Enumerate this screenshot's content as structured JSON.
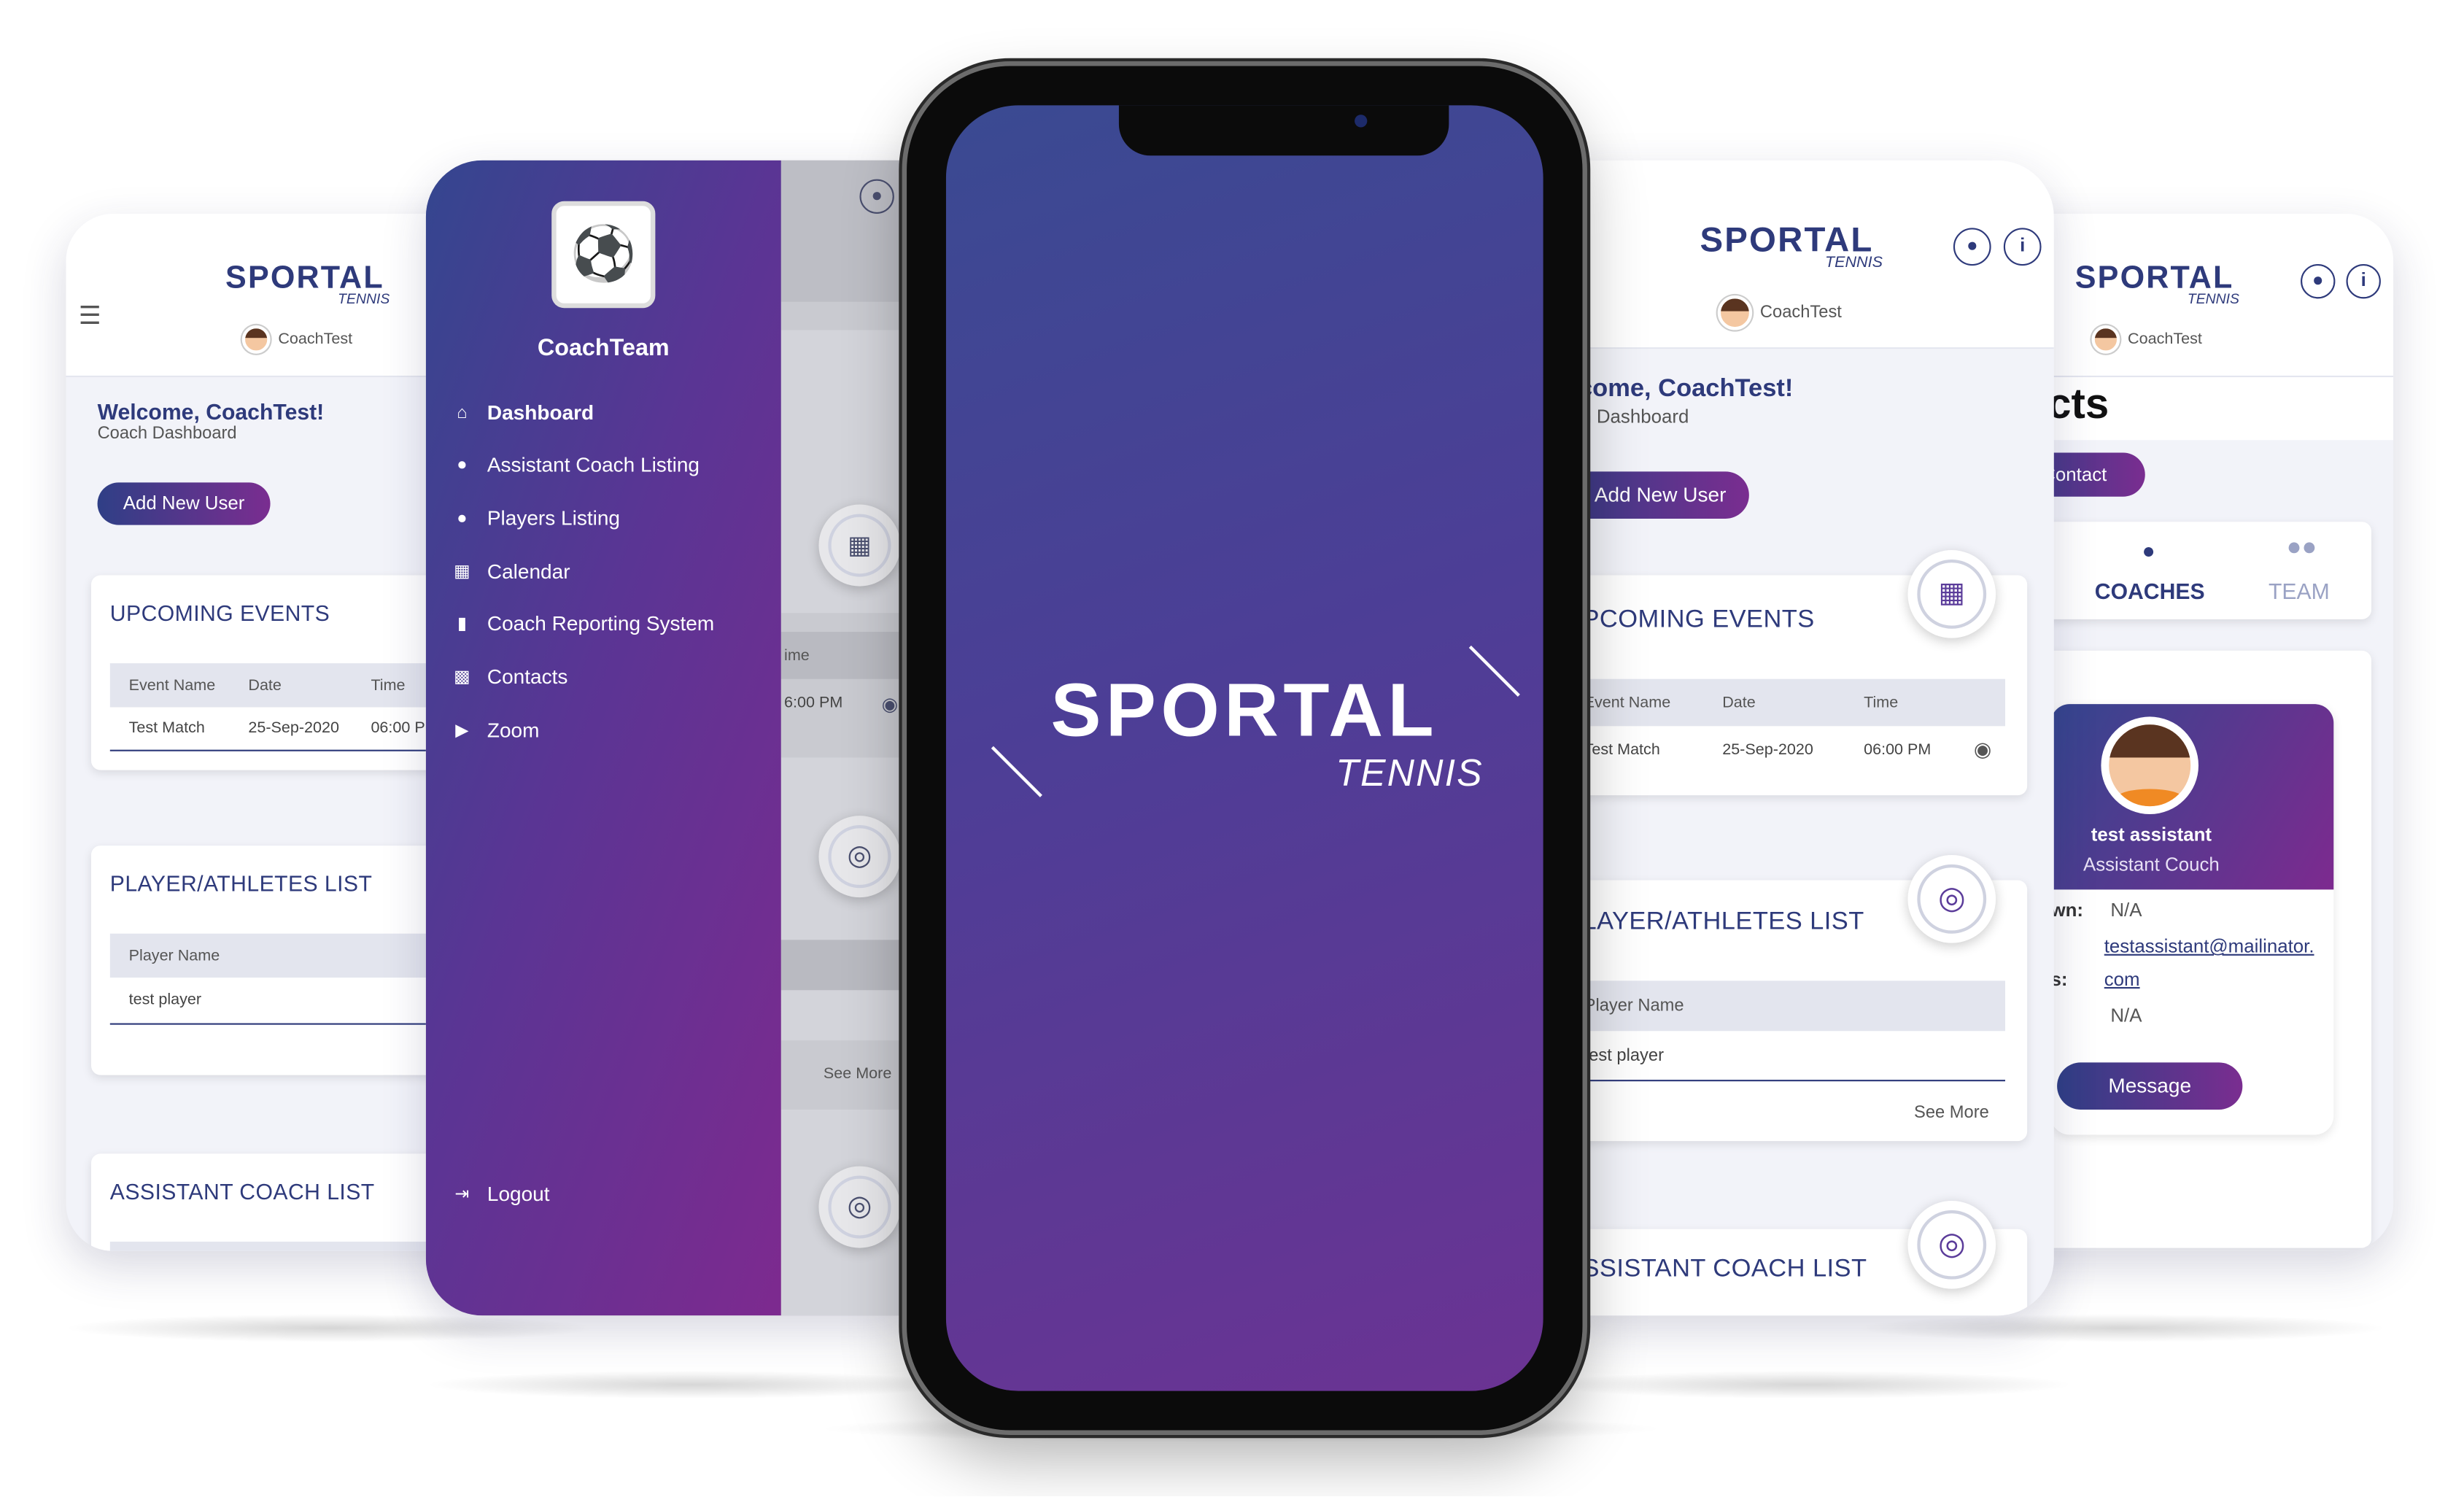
{
  "brand": {
    "logo_main": "SPORTAL",
    "logo_sub": "TENNIS",
    "splash_main": "SPORTAL",
    "splash_sub": "TENNIS"
  },
  "user": {
    "name": "CoachTest"
  },
  "dashboard": {
    "welcome": "Welcome, CoachTest!",
    "subtitle": "Coach Dashboard",
    "add_user": "Add New User",
    "events": {
      "title": "UPCOMING EVENTS",
      "headers": [
        "Event Name",
        "Date",
        "Time"
      ],
      "row": {
        "name": "Test Match",
        "date": "25-Sep-2020",
        "time": "06:00 PM"
      }
    },
    "players": {
      "title": "PLAYER/ATHLETES LIST",
      "header": "Player Name",
      "row": "test player",
      "see_more": "See More"
    },
    "assistants": {
      "title": "ASSISTANT COACH LIST"
    }
  },
  "dashboard_right": {
    "welcome": "lcome, CoachTest!",
    "subtitle": "ch Dashboard",
    "events_title": "PCOMING EVENTS",
    "players_title": "LAYER/ATHLETES LIST",
    "assistants_title": "SSISTANT COACH LIST"
  },
  "drawer": {
    "team": "CoachTeam",
    "items": [
      {
        "label": "Dashboard",
        "icon": "home-icon"
      },
      {
        "label": "Assistant Coach Listing",
        "icon": "group-icon"
      },
      {
        "label": "Players Listing",
        "icon": "group-icon"
      },
      {
        "label": "Calendar",
        "icon": "calendar-icon"
      },
      {
        "label": "Coach Reporting System",
        "icon": "clipboard-icon"
      },
      {
        "label": "Contacts",
        "icon": "book-icon"
      },
      {
        "label": "Zoom",
        "icon": "video-icon"
      }
    ],
    "logout": "Logout",
    "peek": {
      "header": "ime",
      "time": "6:00 PM",
      "see_more": "See More"
    }
  },
  "contacts": {
    "title": "cts",
    "button": "Contact",
    "tabs": [
      "COACHES",
      "TEAM"
    ],
    "person": {
      "name": "test assistant",
      "role": "Assistant Couch"
    },
    "rows": [
      {
        "label": "wn:",
        "value": "N/A"
      },
      {
        "label": "",
        "value": "testassistant@mailinator."
      },
      {
        "label": "s:",
        "value": "com"
      },
      {
        "label": "",
        "value": "N/A"
      }
    ],
    "message": "Message"
  },
  "colors": {
    "primary": "#2e3a7b",
    "accent": "#7c3aad",
    "gradient_start": "#34468f",
    "gradient_end": "#7d2a8f"
  }
}
